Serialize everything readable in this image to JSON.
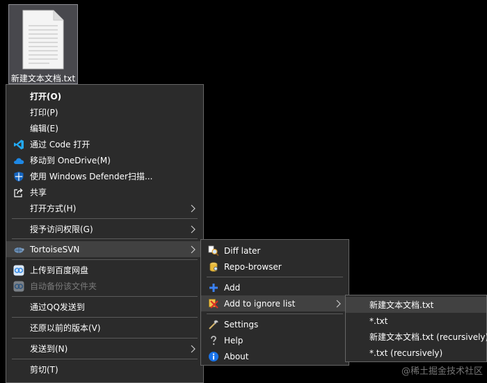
{
  "desktop": {
    "file_label": "新建文本文档.txt"
  },
  "main_menu": {
    "open": "打开(O)",
    "print": "打印(P)",
    "edit": "编辑(E)",
    "open_with_code": "通过 Code 打开",
    "move_to_onedrive": "移动到 OneDrive(M)",
    "scan_defender": "使用 Windows Defender扫描...",
    "share": "共享",
    "open_with": "打开方式(H)",
    "grant_access": "授予访问权限(G)",
    "tortoisesvn": "TortoiseSVN",
    "upload_baidu": "上传到百度网盘",
    "auto_backup": "自动备份该文件夹",
    "send_qq": "通过QQ发送到",
    "restore_previous": "还原以前的版本(V)",
    "send_to": "发送到(N)",
    "cut": "剪切(T)"
  },
  "svn_menu": {
    "diff_later": "Diff later",
    "repo_browser": "Repo-browser",
    "add": "Add",
    "add_to_ignore": "Add to ignore list",
    "settings": "Settings",
    "help": "Help",
    "about": "About"
  },
  "ignore_menu": {
    "items": [
      "新建文本文档.txt",
      "*.txt",
      "新建文本文档.txt (recursively)",
      "*.txt (recursively)"
    ]
  },
  "watermark": "@稀土掘金技术社区",
  "colors": {
    "menu_bg": "#2b2b2b",
    "highlight": "#414141",
    "vscode_blue": "#23a9f2",
    "onedrive_blue": "#1e88e5",
    "defender_blue": "#1565c0"
  }
}
